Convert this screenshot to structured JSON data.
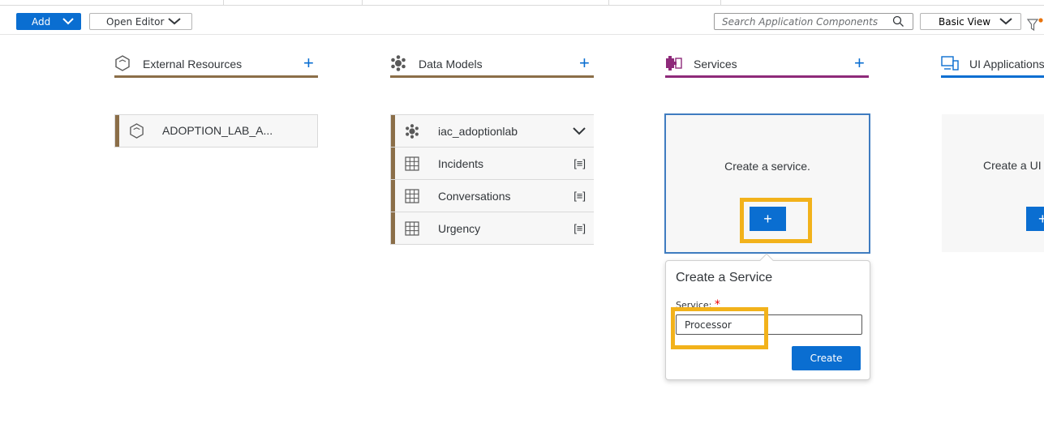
{
  "toolbar": {
    "add_label": "Add",
    "open_editor_label": "Open Editor",
    "search_placeholder": "Search Application Components",
    "view_label": "Basic View"
  },
  "columns": {
    "external": {
      "title": "External Resources",
      "color": "#8b6e48"
    },
    "datamodels": {
      "title": "Data Models",
      "color": "#8b6e48"
    },
    "services": {
      "title": "Services",
      "color": "#8e2a7a"
    },
    "ui": {
      "title": "UI Applications",
      "color": "#0a6ed1"
    }
  },
  "external_card": {
    "label": "ADOPTION_LAB_A..."
  },
  "datamodel": {
    "header": "iac_adoptionlab",
    "rows": [
      {
        "label": "Incidents",
        "right": "[≡]"
      },
      {
        "label": "Conversations",
        "right": "[≡]"
      },
      {
        "label": "Urgency",
        "right": "[≡]"
      }
    ]
  },
  "services_box": {
    "message": "Create a service.",
    "plus": "+"
  },
  "ui_box": {
    "message": "Create a UI",
    "plus": "+"
  },
  "popover": {
    "title": "Create a Service",
    "field_label": "Service:",
    "required_mark": "*",
    "field_value": "Processor",
    "create_label": "Create"
  },
  "colors": {
    "accent": "#0a6ed1",
    "highlight": "#f2b21b",
    "brown": "#8b6e48",
    "purple": "#8e2a7a"
  }
}
